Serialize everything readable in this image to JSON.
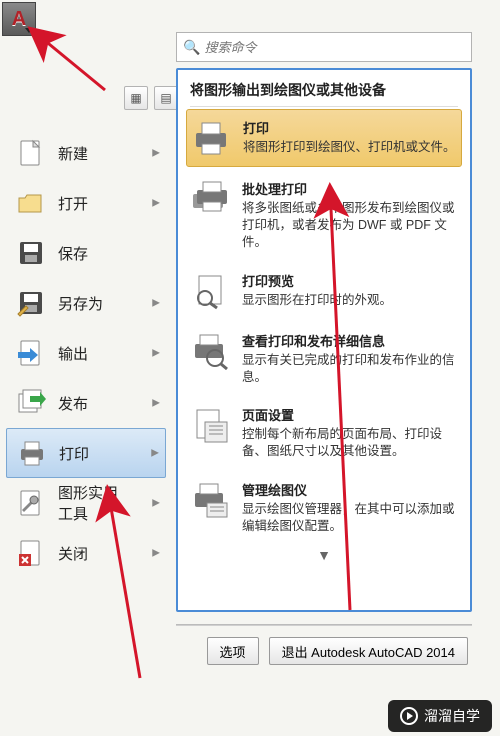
{
  "app": {
    "icon_letter": "A"
  },
  "search": {
    "placeholder": "搜索命令"
  },
  "sidebar": {
    "items": [
      {
        "label": "新建",
        "icon": "file-new",
        "has_sub": true
      },
      {
        "label": "打开",
        "icon": "folder-open",
        "has_sub": true
      },
      {
        "label": "保存",
        "icon": "save",
        "has_sub": false
      },
      {
        "label": "另存为",
        "icon": "save-as",
        "has_sub": true
      },
      {
        "label": "输出",
        "icon": "export",
        "has_sub": true
      },
      {
        "label": "发布",
        "icon": "publish",
        "has_sub": true
      },
      {
        "label": "打印",
        "icon": "print",
        "has_sub": true,
        "selected": true
      },
      {
        "label": "图形实用\n工具",
        "icon": "tools",
        "has_sub": true
      },
      {
        "label": "关闭",
        "icon": "close",
        "has_sub": true
      }
    ]
  },
  "flyout": {
    "title": "将图形输出到绘图仪或其他设备",
    "items": [
      {
        "name": "打印",
        "desc": "将图形打印到绘图仪、打印机或文件。",
        "icon": "printer",
        "highlight": true
      },
      {
        "name": "批处理打印",
        "desc": "将多张图纸或多个图形发布到绘图仪或打印机，或者发布为 DWF 或 PDF 文件。",
        "icon": "printer-batch"
      },
      {
        "name": "打印预览",
        "desc": "显示图形在打印时的外观。",
        "icon": "print-preview"
      },
      {
        "name": "查看打印和发布详细信息",
        "desc": "显示有关已完成的打印和发布作业的信息。",
        "icon": "print-details"
      },
      {
        "name": "页面设置",
        "desc": "控制每个新布局的页面布局、打印设备、图纸尺寸以及其他设置。",
        "icon": "page-setup"
      },
      {
        "name": "管理绘图仪",
        "desc": "显示绘图仪管理器，在其中可以添加或编辑绘图仪配置。",
        "icon": "plotter-manager"
      }
    ],
    "more": "▼"
  },
  "bottom": {
    "options": "选项",
    "exit": "退出 Autodesk AutoCAD 2014"
  },
  "watermark": "溜溜自学"
}
